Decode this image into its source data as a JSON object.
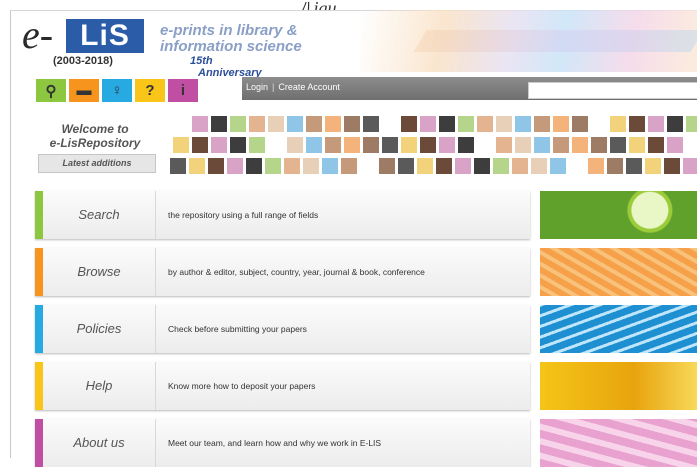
{
  "cropped_heading": "ﾊ igu",
  "logo": {
    "prefix": "e-",
    "name": "LiS",
    "years": "(2003-2018)"
  },
  "tagline": {
    "line1": "e-prints in library &",
    "line2": "information science"
  },
  "anniversary": {
    "number": "15th",
    "label": "Anniversary"
  },
  "toolbar_icons": [
    {
      "icon": "search-icon",
      "color": "#8dc63f",
      "glyph": "⚲"
    },
    {
      "icon": "folder-icon",
      "color": "#f7941d",
      "glyph": "▬"
    },
    {
      "icon": "key-icon",
      "color": "#27aae1",
      "glyph": "♀"
    },
    {
      "icon": "help-icon",
      "color": "#f9c519",
      "glyph": "?"
    },
    {
      "icon": "info-icon",
      "color": "#c04fa3",
      "glyph": "i"
    }
  ],
  "nav": {
    "login": "Login",
    "create_account": "Create Account",
    "search_value": ""
  },
  "welcome": {
    "line1": "Welcome to",
    "line2": "e-LisRepository",
    "latest_button": "Latest additions"
  },
  "menu": [
    {
      "title": "Search",
      "description": "the repository using a full range of fields",
      "color": "#8dc63f"
    },
    {
      "title": "Browse",
      "description": "by author & editor, subject, country, year, journal & book, conference",
      "color": "#f7941d"
    },
    {
      "title": "Policies",
      "description": "Check before submitting your papers",
      "color": "#27aae1"
    },
    {
      "title": "Help",
      "description": "Know more how to deposit your papers",
      "color": "#f9c519"
    },
    {
      "title": "About us",
      "description": "Meet our team, and learn how and why we work in E-LIS",
      "color": "#c04fa3"
    }
  ]
}
